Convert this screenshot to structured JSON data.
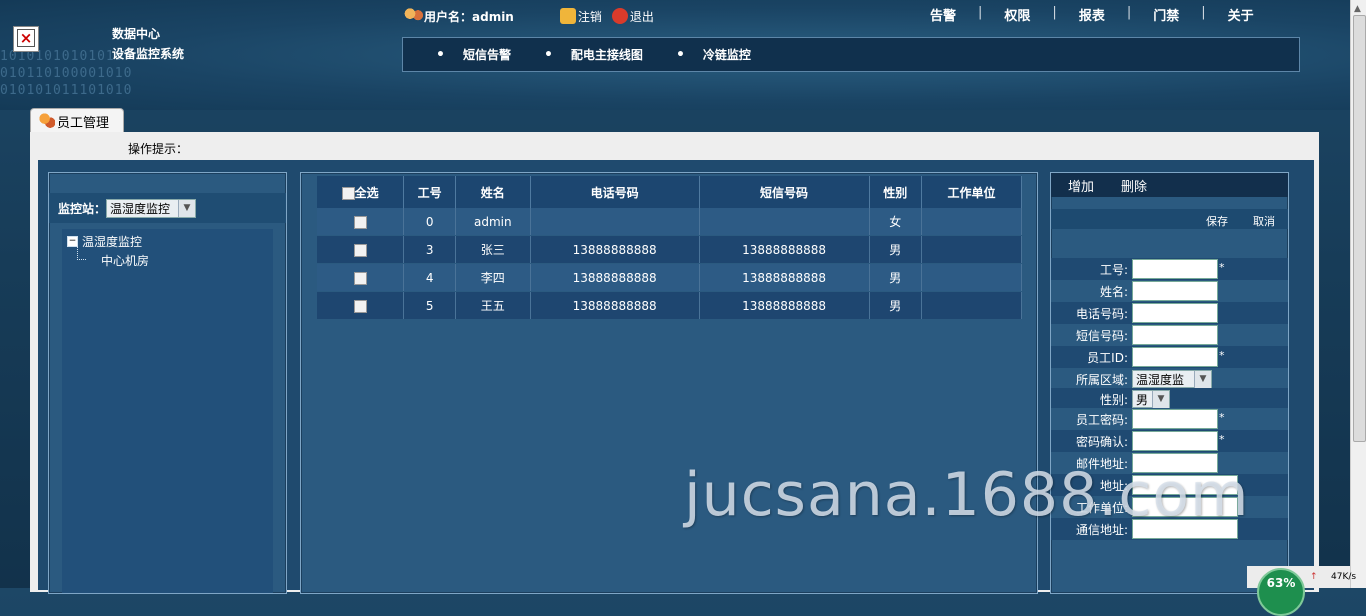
{
  "header": {
    "binary_deco": [
      "10101010101010",
      "010110100001010",
      "010101011101010"
    ],
    "title_line1": "数据中心",
    "title_line2": "设备监控系统",
    "user_label": "用户名：admin",
    "logout": "注销",
    "exit": "退出",
    "top_menu": [
      "告警",
      "权限",
      "报表",
      "门禁",
      "关于"
    ],
    "separator": "|",
    "nav": [
      "短信告警",
      "配电主接线图",
      "冷链监控"
    ],
    "nav_dot": "•"
  },
  "tab": {
    "label": "员工管理"
  },
  "tip": {
    "label": "操作提示："
  },
  "left": {
    "station_label": "监控站：",
    "station_value": "温湿度监控",
    "tree_root": "温湿度监控",
    "tree_child": "中心机房"
  },
  "table": {
    "headers": [
      "全选",
      "工号",
      "姓名",
      "电话号码",
      "短信号码",
      "性别",
      "工作单位"
    ],
    "rows": [
      [
        "0",
        "admin",
        "",
        "",
        "女",
        ""
      ],
      [
        "3",
        "张三",
        "13888888888",
        "13888888888",
        "男",
        ""
      ],
      [
        "4",
        "李四",
        "13888888888",
        "13888888888",
        "男",
        ""
      ],
      [
        "5",
        "王五",
        "13888888888",
        "13888888888",
        "男",
        ""
      ]
    ]
  },
  "form": {
    "add": "增加",
    "delete": "删除",
    "save": "保存",
    "cancel": "取消",
    "required_mark": "*",
    "fields": {
      "emp_no": "工号:",
      "name": "姓名:",
      "phone": "电话号码:",
      "sms": "短信号码:",
      "emp_id": "员工ID:",
      "area": "所属区域:",
      "gender": "性别:",
      "password": "员工密码:",
      "password_confirm": "密码确认:",
      "email": "邮件地址:",
      "address": "地址:",
      "work_unit": "工作单位:",
      "mail_address": "通信地址:"
    },
    "area_value": "温湿度监",
    "gender_value": "男"
  },
  "watermark": "jucsana.1688.com",
  "netspeed": {
    "percent": "63%",
    "speed": "47K/s"
  }
}
